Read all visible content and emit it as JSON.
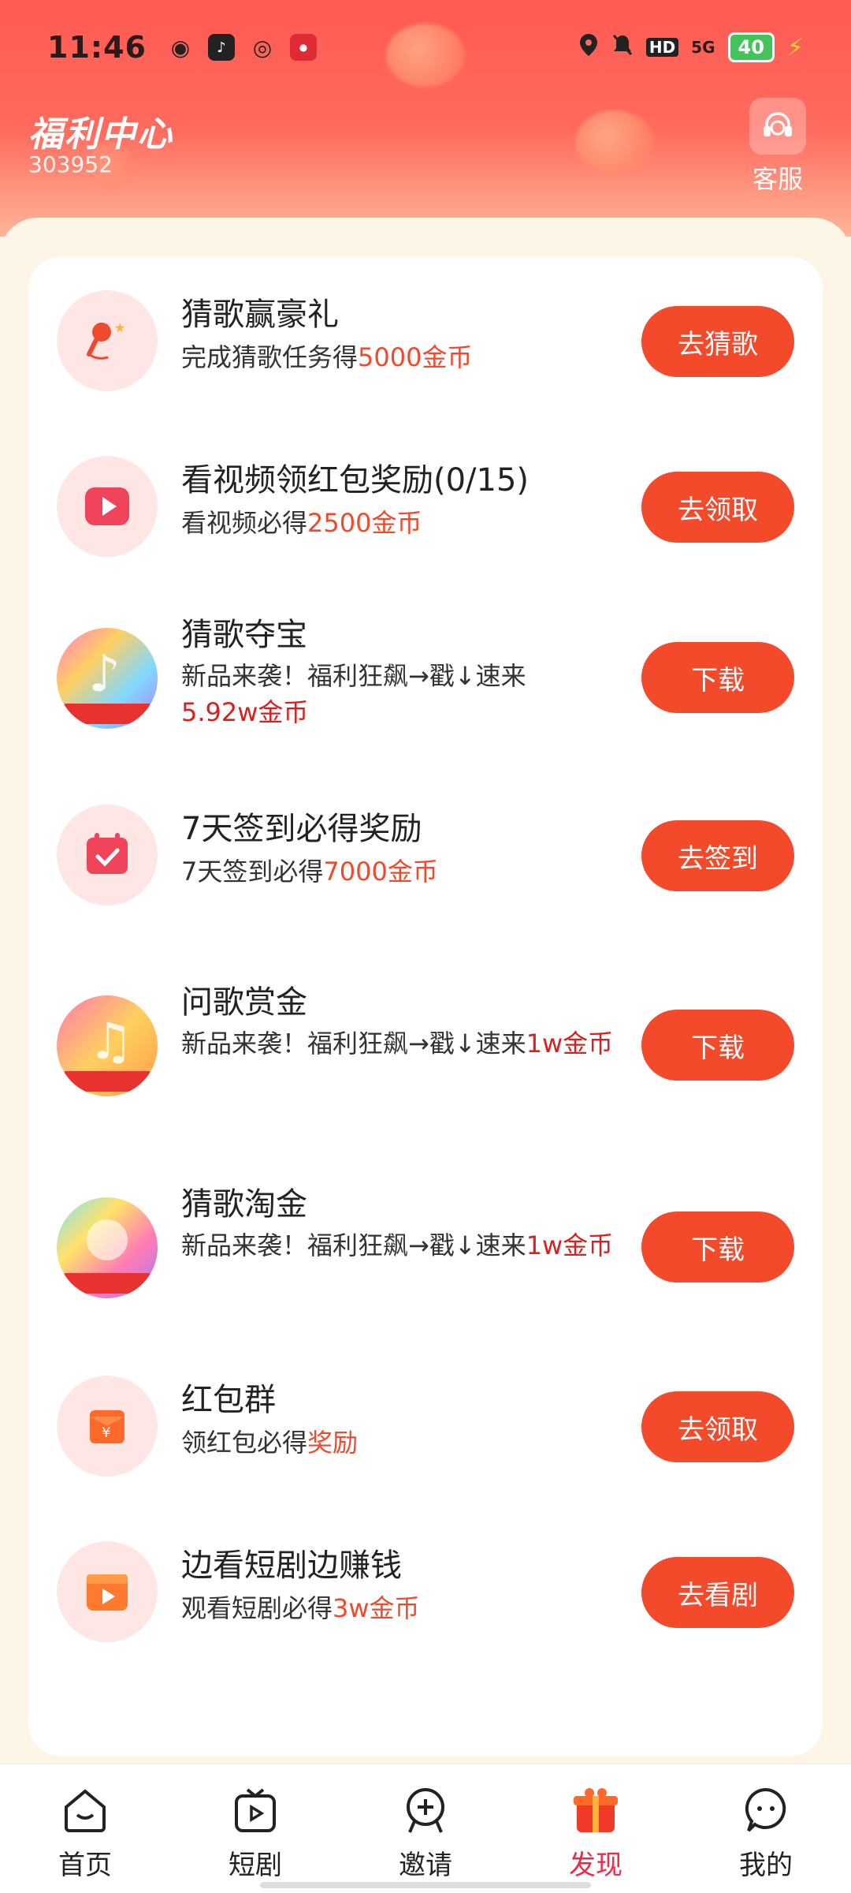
{
  "status_bar": {
    "time": "11:46",
    "battery": "40",
    "network": "5G",
    "hd_badge": "HD"
  },
  "header": {
    "title": "福利中心",
    "user_id": "303952",
    "service_label": "客服"
  },
  "tasks": [
    {
      "title": "猜歌赢豪礼",
      "desc_prefix": "完成猜歌任务得",
      "desc_highlight": "5000金币",
      "button": "去猜歌",
      "icon": "microphone-icon"
    },
    {
      "title": "看视频领红包奖励(0/15)",
      "desc_prefix": "看视频必得",
      "desc_highlight": "2500金币",
      "button": "去领取",
      "icon": "video-play-icon"
    },
    {
      "title": "猜歌夺宝",
      "desc_prefix": "新品来袭！福利狂飙→戳↓速来",
      "desc_highlight": "5.92w金币",
      "button": "下载",
      "icon": "music-app-icon",
      "icon_caption": "超大红包"
    },
    {
      "title": "7天签到必得奖励",
      "desc_prefix": "7天签到必得",
      "desc_highlight": "7000金币",
      "button": "去签到",
      "icon": "calendar-check-icon"
    },
    {
      "title": "问歌赏金",
      "desc_prefix": "新品来袭！福利狂飙→戳↓速来",
      "desc_highlight": "1w金币",
      "button": "下载",
      "icon": "music-app-icon",
      "icon_caption": "天天领红包"
    },
    {
      "title": "猜歌淘金",
      "desc_prefix": "新品来袭！福利狂飙→戳↓速来",
      "desc_highlight": "1w金币",
      "button": "下载",
      "icon": "music-app-icon",
      "icon_caption": "急速提现"
    },
    {
      "title": "红包群",
      "desc_prefix": "领红包必得",
      "desc_highlight": "奖励",
      "button": "去领取",
      "icon": "red-envelope-icon"
    },
    {
      "title": "边看短剧边赚钱",
      "desc_prefix": "观看短剧必得",
      "desc_highlight": "3w金币",
      "button": "去看剧",
      "icon": "short-drama-icon"
    }
  ],
  "tabbar": {
    "items": [
      {
        "label": "首页",
        "icon": "home-face-icon",
        "active": false
      },
      {
        "label": "短剧",
        "icon": "tv-play-icon",
        "active": false
      },
      {
        "label": "邀请",
        "icon": "invite-add-icon",
        "active": false
      },
      {
        "label": "发现",
        "icon": "gift-box-icon",
        "active": true
      },
      {
        "label": "我的",
        "icon": "profile-face-icon",
        "active": false
      }
    ]
  },
  "colors": {
    "accent": "#f34a2b",
    "highlight": "#ee4a2d",
    "header_top": "#ff5a52",
    "active_tab": "#ee2a4a"
  }
}
